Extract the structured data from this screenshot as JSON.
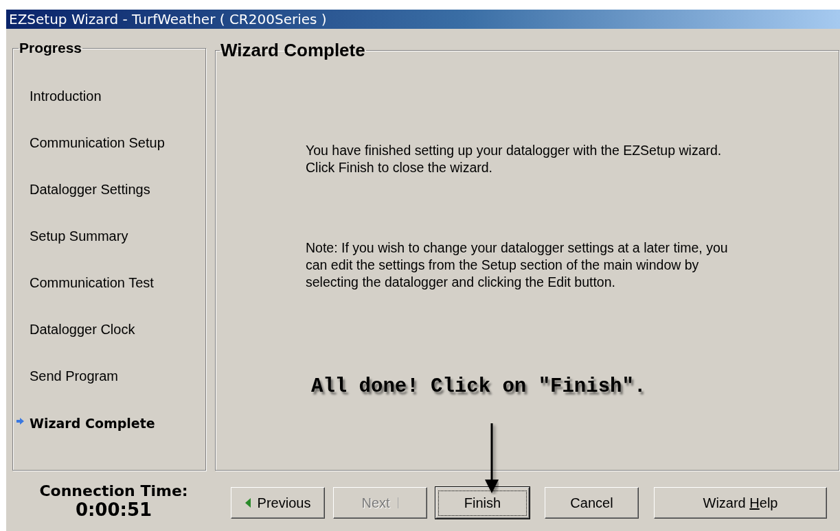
{
  "window": {
    "title": "EZSetup Wizard - TurfWeather ( CR200Series )"
  },
  "progress": {
    "title": "Progress",
    "steps": [
      {
        "label": "Introduction",
        "selected": false
      },
      {
        "label": "Communication Setup",
        "selected": false
      },
      {
        "label": "Datalogger Settings",
        "selected": false
      },
      {
        "label": "Setup Summary",
        "selected": false
      },
      {
        "label": "Communication Test",
        "selected": false
      },
      {
        "label": "Datalogger Clock",
        "selected": false
      },
      {
        "label": "Send Program",
        "selected": false
      },
      {
        "label": "Wizard Complete",
        "selected": true
      }
    ]
  },
  "page": {
    "title": "Wizard Complete",
    "paragraphs": [
      "You have finished setting up your datalogger with the EZSetup wizard.\nClick Finish to close the wizard.",
      "Note: If you wish to change your datalogger settings at a later time, you\ncan edit the settings from the Setup section of the main window by\nselecting the datalogger and clicking the Edit button."
    ]
  },
  "annotation": {
    "text": "All done! Click on \"Finish\"."
  },
  "connection": {
    "label": "Connection Time:",
    "value": "0:00:51"
  },
  "buttons": [
    {
      "label": "Previous",
      "kind": "back",
      "disabled": false,
      "default": false
    },
    {
      "label": "Next",
      "kind": "forward",
      "disabled": true,
      "default": false
    },
    {
      "label": "Finish",
      "kind": "plain",
      "disabled": false,
      "default": true
    },
    {
      "label": "Cancel",
      "kind": "plain",
      "disabled": false,
      "default": false
    },
    {
      "label_before": "Wizard ",
      "access_key": "H",
      "label_after": "elp",
      "kind": "plain",
      "disabled": false,
      "default": false
    }
  ]
}
